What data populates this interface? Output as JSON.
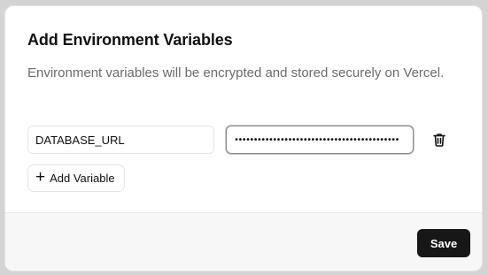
{
  "dialog": {
    "title": "Add Environment Variables",
    "description": "Environment variables will be encrypted and stored securely on Vercel."
  },
  "variables": [
    {
      "key": "DATABASE_URL",
      "value_masked": "•••••••••••••••••••••••••••••••••••••••••••",
      "delete_icon": "trash-icon"
    }
  ],
  "actions": {
    "add_variable_label": "Add Variable",
    "add_icon": "plus-icon",
    "save_label": "Save"
  },
  "colors": {
    "primary_button": "#171717",
    "primary_button_text": "#ffffff",
    "footer_background": "#f7f7f7",
    "muted_text": "#6b6b6b"
  }
}
